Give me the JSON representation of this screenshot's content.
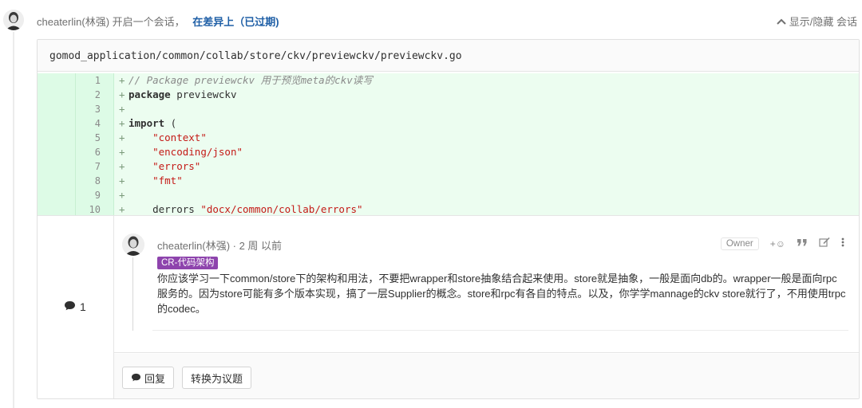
{
  "event": {
    "author": "cheaterlin(林强)",
    "action": "开启一个会话，",
    "link": "在差异上（已过期)",
    "toggle": "显示/隐藏 会话"
  },
  "file": {
    "path": "gomod_application/common/collab/store/ckv/previewckv/previewckv.go"
  },
  "diff_lines": [
    {
      "n": "1",
      "sign": "+"
    },
    {
      "n": "2",
      "sign": "+"
    },
    {
      "n": "3",
      "sign": "+"
    },
    {
      "n": "4",
      "sign": "+"
    },
    {
      "n": "5",
      "sign": "+"
    },
    {
      "n": "6",
      "sign": "+"
    },
    {
      "n": "7",
      "sign": "+"
    },
    {
      "n": "8",
      "sign": "+"
    },
    {
      "n": "9",
      "sign": "+"
    },
    {
      "n": "10",
      "sign": "+"
    }
  ],
  "code": {
    "l1": "// Package previewckv 用于预览meta的ckv读写",
    "l2_kw": "package",
    "l2_rest": " previewckv",
    "l4_kw": "import",
    "l4_rest": " (",
    "l5": "\"context\"",
    "l6": "\"encoding/json\"",
    "l7": "\"errors\"",
    "l8": "\"fmt\"",
    "l10_name": "derrors ",
    "l10_str": "\"docx/common/collab/errors\""
  },
  "discussion": {
    "count": "1",
    "note": {
      "author": "cheaterlin(林强) · 2 周 以前",
      "role": "Owner",
      "emoji": "+☺",
      "label": "CR-代码架构",
      "text": "你应该学习一下common/store下的架构和用法，不要把wrapper和store抽象结合起来使用。store就是抽象，一般是面向db的。wrapper一般是面向rpc服务的。因为store可能有多个版本实现，搞了一层Supplier的概念。store和rpc有各自的特点。以及，你学学mannage的ckv store就行了，不用使用trpc的codec。"
    },
    "reply_label": "回复",
    "convert_label": "转换为议题"
  },
  "colors": {
    "added_gutter": "#ddfbe6",
    "added_code": "#ecfdf0",
    "label_purple": "#8e44ad",
    "link_blue": "#1f5fa6",
    "string_red": "#c41a16"
  }
}
